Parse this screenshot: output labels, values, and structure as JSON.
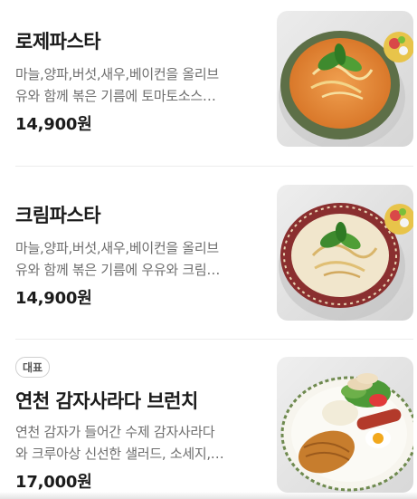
{
  "menu": {
    "items": [
      {
        "name": "로제파스타",
        "desc_line1": "마늘,양파,버섯,새우,베이컨을 올리브",
        "desc_line2": "유와 함께 볶은 기름에 토마토소스…",
        "price": "14,900원",
        "image_icon": "rose-pasta-photo"
      },
      {
        "name": "크림파스타",
        "desc_line1": "마늘,양파,버섯,새우,베이컨을 올리브",
        "desc_line2": "유와 함께 볶은 기름에 우유와 크림…",
        "price": "14,900원",
        "image_icon": "cream-pasta-photo"
      },
      {
        "badge": "대표",
        "name": "연천 감자사라다 브런치",
        "desc_line1": "연천 감자가 들어간 수제 감자사라다",
        "desc_line2": "와 크루아상 신선한 샐러드, 소세지,…",
        "price": "17,000원",
        "image_icon": "potato-salad-brunch-photo"
      }
    ]
  },
  "colors": {
    "text_primary": "#1b1b1b",
    "text_secondary": "#6e6e6e",
    "divider": "#ececec"
  }
}
